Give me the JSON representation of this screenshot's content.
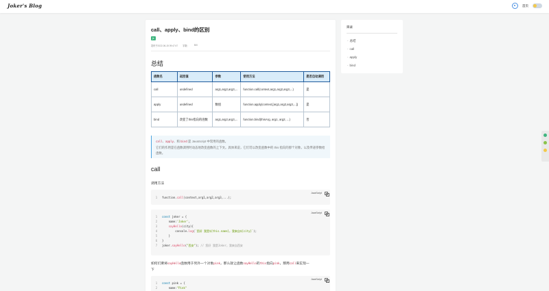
{
  "header": {
    "logo": "Joker's Blog",
    "home_label": "首页"
  },
  "post": {
    "title": "call、apply、bind的区别",
    "tag": "js",
    "meta": {
      "published": "发布于2022-06-15 09:47:47",
      "words": "字数：",
      "views": "500"
    },
    "sections": {
      "summary_heading": "总结",
      "call_heading": "call"
    },
    "table": {
      "headers": [
        "函数名",
        "返回值",
        "参数",
        "使用方法",
        "是否自动调用"
      ],
      "rows": [
        [
          "call",
          "undefined",
          "arg1,arg2,arg3,...",
          "function.call(context,arg1,arg2,arg3,...)",
          "是"
        ],
        [
          "apply",
          "undefined",
          "数组",
          "function.apply(context,[arg1,arg2,arg3,...])",
          "是"
        ],
        [
          "bind",
          "改变了this指向的函数",
          "arg1,arg2,arg3,...",
          "function.bind(thisArg, arg1, arg2, ...)",
          "否"
        ]
      ]
    },
    "note": {
      "code1": "call",
      "sep1": "、",
      "code2": "apply",
      "sep2": "、和",
      "code3": "bind",
      "rest1": "是 JavaScript 中常用的函数。",
      "line2": "它们的作用是在函数调用时动态地改变函数的上下文。具体来说，它们可以改变函数中的 this 指向的那个对象，以及传递参数给函数。"
    },
    "usage_label": "调用方法",
    "code_lang": "JavaScript",
    "code1": [
      "function.call(context,arg1,arg2,arg3,...);"
    ],
    "para2": {
      "a": "如何们要将",
      "c1": "sayHello",
      "b": "函数用于另外一个对象",
      "c2": "pink",
      "c": "，那么就让函数",
      "c3": "sayHello",
      "d": "的",
      "c4": "this",
      "e": "指向",
      "c5": "pink",
      "f": "，那用",
      "c6": "call",
      "g": "来实现一",
      "h": "下"
    }
  },
  "toc": {
    "title": "目录",
    "items": [
      "总结",
      "call",
      "apply",
      "bind"
    ]
  },
  "colors": {
    "accent": "#4aa3df",
    "tag": "#3fb57f",
    "table_header_bg": "#d9ecf9",
    "inline_code": "#c9354e"
  }
}
